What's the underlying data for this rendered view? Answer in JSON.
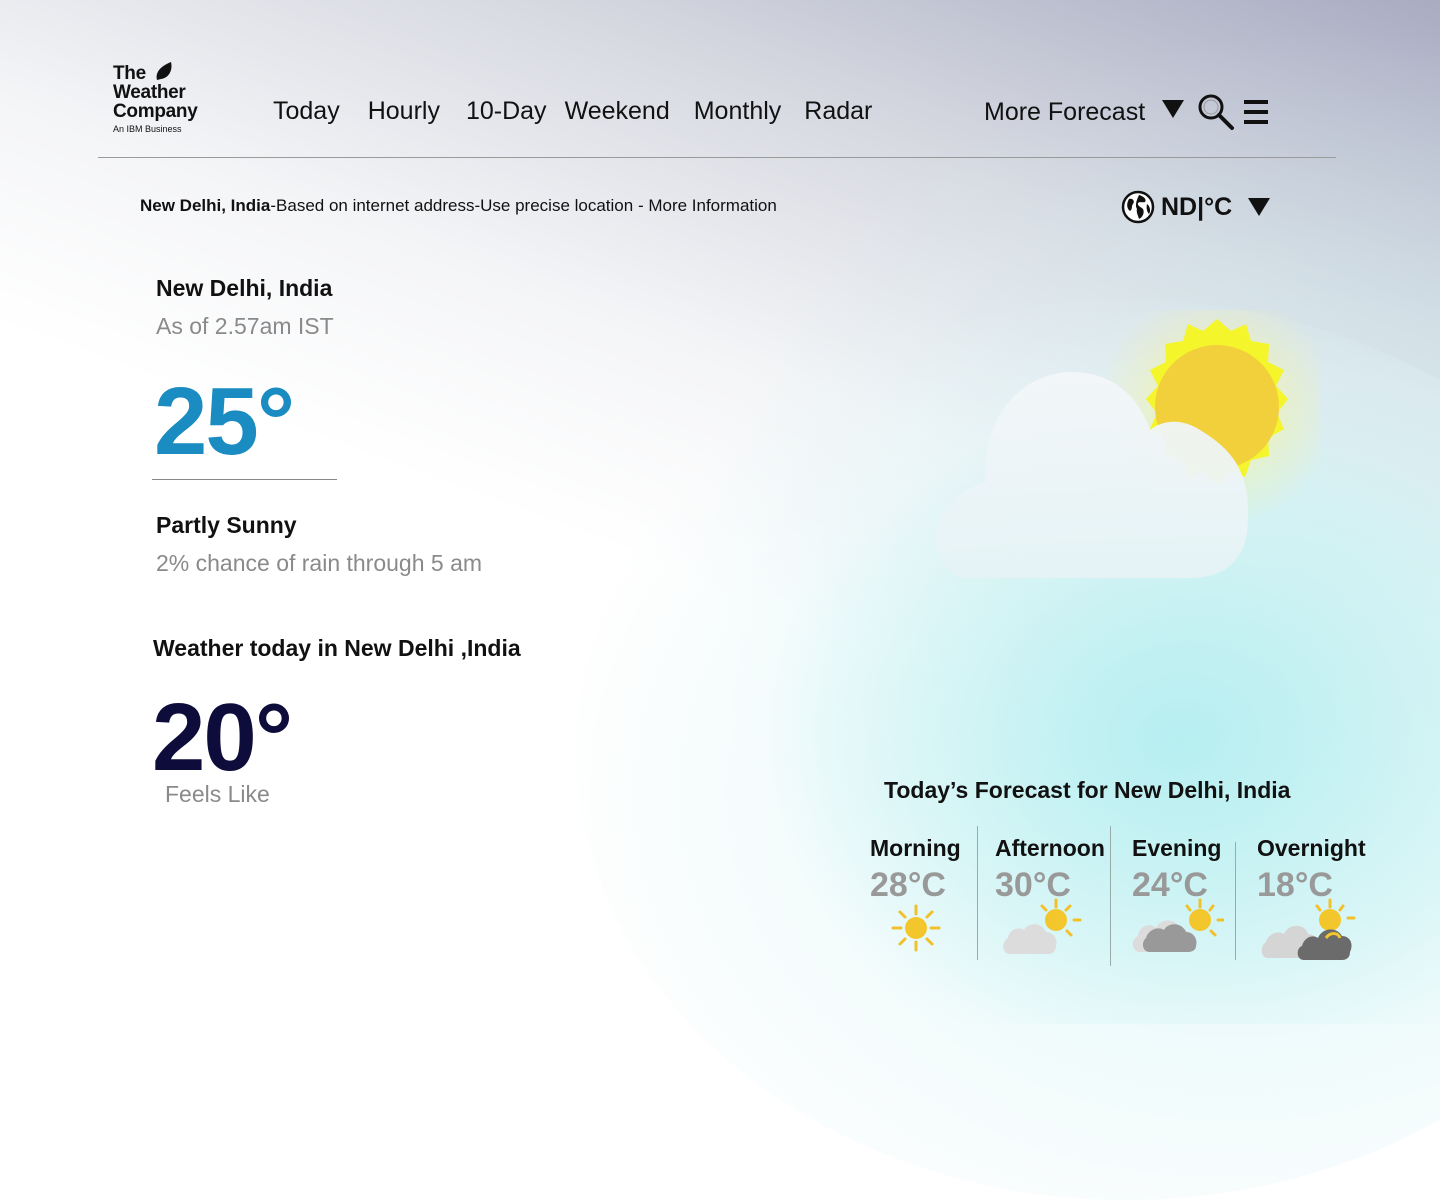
{
  "brand": {
    "line1": "The",
    "line2": "Weather",
    "line3": "Company",
    "tagline": "An IBM Business"
  },
  "nav": {
    "items": [
      "Today",
      "Hourly",
      "10-Day",
      "Weekend",
      "Monthly",
      "Radar"
    ],
    "more_forecast": "More Forecast"
  },
  "location_bar": {
    "city": "New Delhi, India",
    "text": "-Based on internet address-Use precise location - More Information"
  },
  "unit_selector": {
    "label": "ND|°C"
  },
  "current": {
    "city": "New Delhi, India",
    "as_of": "As of 2.57am IST",
    "temperature": "25°",
    "condition": "Partly Sunny",
    "rain_chance": "2% chance of rain through 5 am"
  },
  "today": {
    "title": "Weather today in New Delhi ,India",
    "feels_like_value": "20°",
    "feels_like_label": "Feels Like"
  },
  "forecast": {
    "title": "Today’s Forecast for New Delhi, India",
    "periods": [
      {
        "name": "Morning",
        "temp": "28°C",
        "icon": "sun-icon"
      },
      {
        "name": "Afternoon",
        "temp": "30°C",
        "icon": "partly-sunny-icon"
      },
      {
        "name": "Evening",
        "temp": "24°C",
        "icon": "cloudy-sun-icon"
      },
      {
        "name": "Overnight",
        "temp": "18°C",
        "icon": "night-cloud-icon"
      }
    ]
  },
  "colors": {
    "temp_accent": "#1a8cc1",
    "feels_like": "#0d0c3a",
    "sun": "#f2d03b",
    "sun_rays": "#f4f52a"
  }
}
